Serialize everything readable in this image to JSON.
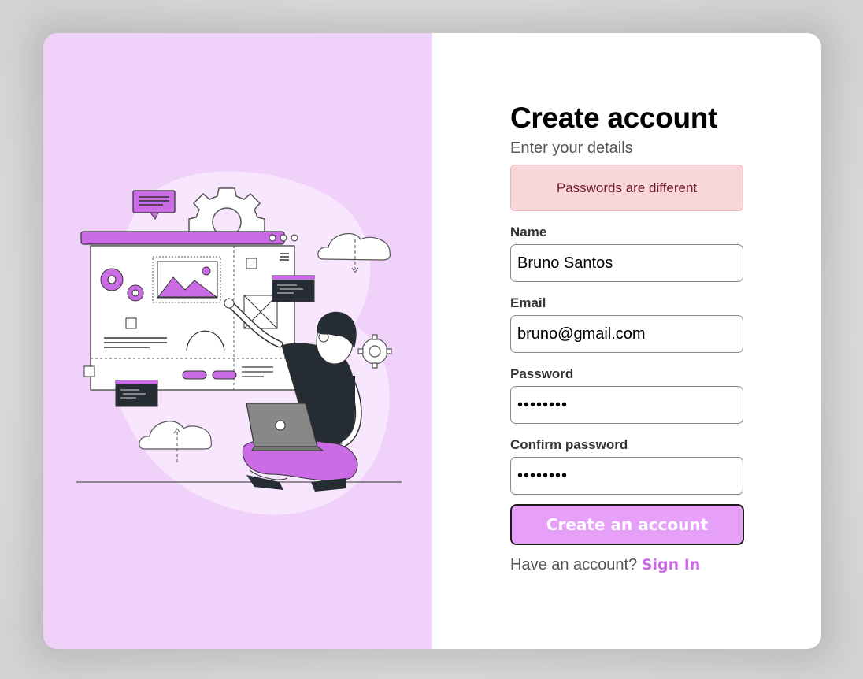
{
  "form": {
    "title": "Create account",
    "subtitle": "Enter your details",
    "error": "Passwords are different",
    "fields": {
      "name": {
        "label": "Name",
        "value": "Bruno Santos"
      },
      "email": {
        "label": "Email",
        "value": "bruno@gmail.com"
      },
      "password": {
        "label": "Password",
        "value": "••••••••"
      },
      "confirm": {
        "label": "Confirm password",
        "value": "••••••••"
      }
    },
    "submit_label": "Create an account",
    "signin_prompt": "Have an account?",
    "signin_link": "Sign In"
  },
  "colors": {
    "left_panel_bg": "#f0d1fa",
    "accent": "#cc6be6",
    "button_bg": "#e7a0f8",
    "alert_bg": "#f8d7da",
    "alert_text": "#721c24"
  },
  "illustration": {
    "icon": "developer-web-design-illustration"
  }
}
